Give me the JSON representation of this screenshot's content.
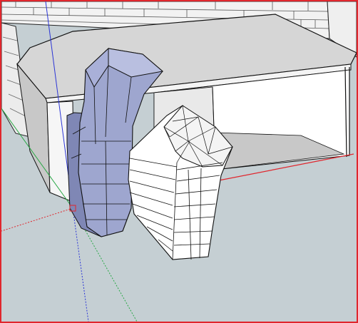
{
  "app": "SketchUp",
  "view": "3d-model-viewport",
  "colors": {
    "viewport_border": "#e0262d",
    "sky": "#dfe7ea",
    "ground": "#c5cfd3",
    "selected_face": "#9ea6cf",
    "selected_face_dark": "#7f87b5",
    "face_light": "#ffffff",
    "face_gray": "#d4d4d4",
    "edge": "#000000",
    "axis_red": "#e0262d",
    "axis_green": "#28a745",
    "axis_blue": "#2b35d6"
  },
  "icons": [
    "axes-origin-icon"
  ]
}
